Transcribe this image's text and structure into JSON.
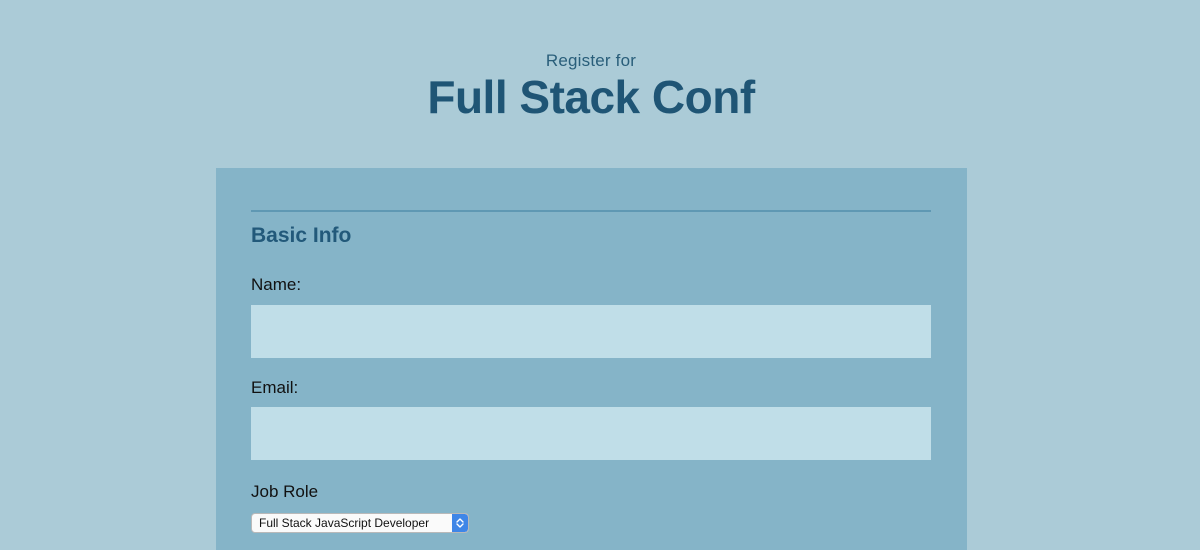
{
  "header": {
    "subtitle": "Register for",
    "title": "Full Stack Conf"
  },
  "form": {
    "section_title": "Basic Info",
    "name_label": "Name:",
    "name_value": "",
    "email_label": "Email:",
    "email_value": "",
    "job_role_label": "Job Role",
    "job_role_selected": "Full Stack JavaScript Developer"
  },
  "colors": {
    "page_background": "#abcbd7",
    "card_background": "#85b4c8",
    "input_background": "#c0dee8",
    "heading": "#1f5575",
    "select_accent": "#3f86e7"
  },
  "icons": {
    "select_arrows": "chevron-up-down-icon"
  }
}
